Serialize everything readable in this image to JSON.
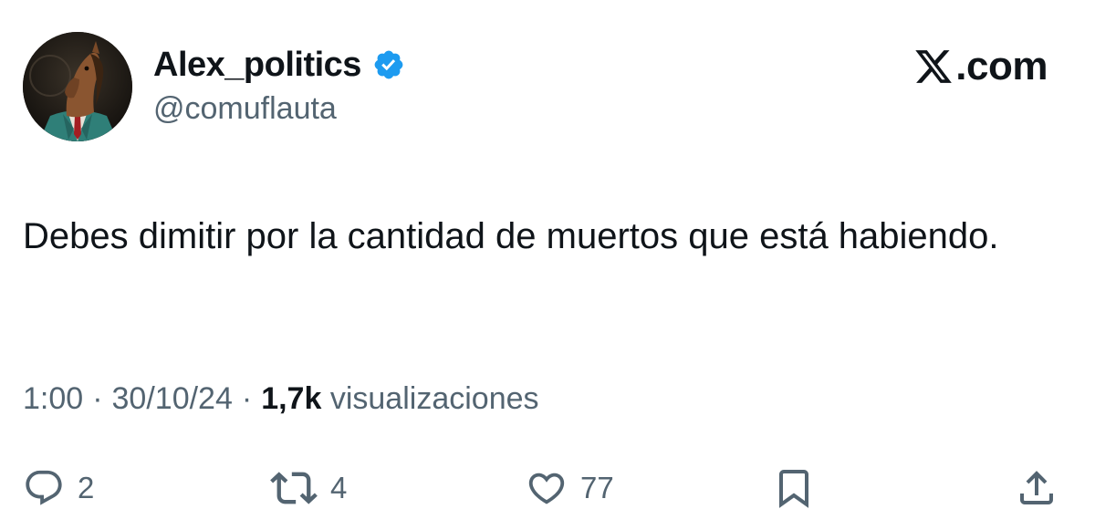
{
  "author": {
    "display_name": "Alex_politics",
    "handle": "@comuflauta",
    "verified": true,
    "avatar_icon": "horse-in-suit-avatar"
  },
  "brand": {
    "icon": "x-logo-icon",
    "domain": ".com"
  },
  "tweet": {
    "text": "Debes dimitir por la cantidad de muertos que está habiendo."
  },
  "meta": {
    "time": "1:00",
    "separator1": "·",
    "date": "30/10/24",
    "separator2": "·",
    "views_count": "1,7k",
    "views_label": "visualizaciones"
  },
  "actions": {
    "replies": "2",
    "retweets": "4",
    "likes": "77"
  },
  "colors": {
    "text": "#0f1419",
    "secondary": "#536471",
    "verified_blue": "#1d9bf0"
  }
}
